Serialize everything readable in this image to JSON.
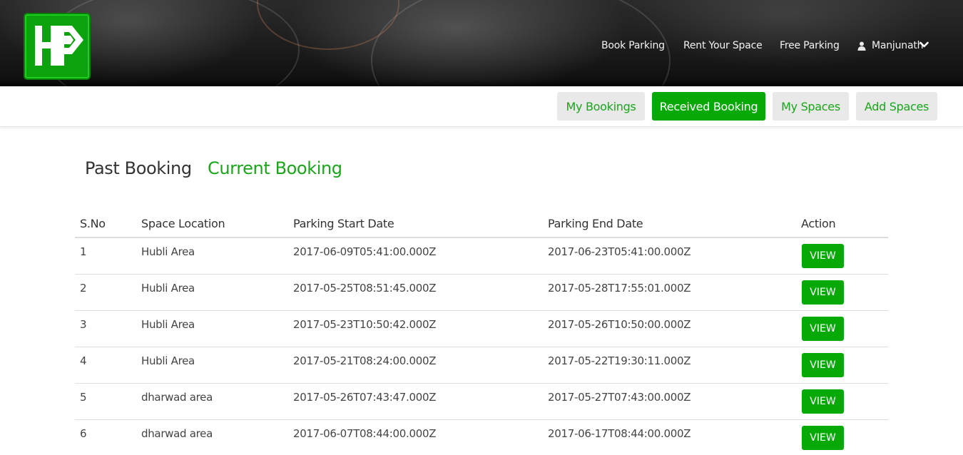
{
  "header": {
    "nav": {
      "book_parking": "Book Parking",
      "rent_space": "Rent Your Space",
      "free_parking": "Free Parking",
      "user_name": "Manjunath"
    },
    "icons": {
      "user": "user-icon",
      "dropdown": "chevron-down-icon"
    }
  },
  "subnav": {
    "tabs": [
      {
        "label": "My Bookings",
        "active": false
      },
      {
        "label": "Received Booking",
        "active": true
      },
      {
        "label": "My Spaces",
        "active": false
      },
      {
        "label": "Add Spaces",
        "active": false
      }
    ]
  },
  "booking_toggle": {
    "past": "Past Booking",
    "current": "Current Booking",
    "selected": "current"
  },
  "table": {
    "headers": {
      "sno": "S.No",
      "location": "Space Location",
      "start": "Parking Start Date",
      "end": "Parking End Date",
      "action": "Action"
    },
    "view_label": "VIEW",
    "rows": [
      {
        "sno": "1",
        "location": "Hubli Area",
        "start": "2017-06-09T05:41:00.000Z",
        "end": "2017-06-23T05:41:00.000Z"
      },
      {
        "sno": "2",
        "location": "Hubli Area",
        "start": "2017-05-25T08:51:45.000Z",
        "end": "2017-05-28T17:55:01.000Z"
      },
      {
        "sno": "3",
        "location": "Hubli Area",
        "start": "2017-05-23T10:50:42.000Z",
        "end": "2017-05-26T10:50:00.000Z"
      },
      {
        "sno": "4",
        "location": "Hubli Area",
        "start": "2017-05-21T08:24:00.000Z",
        "end": "2017-05-22T19:30:11.000Z"
      },
      {
        "sno": "5",
        "location": "dharwad area",
        "start": "2017-05-26T07:43:47.000Z",
        "end": "2017-05-27T07:43:00.000Z"
      },
      {
        "sno": "6",
        "location": "dharwad area",
        "start": "2017-06-07T08:44:00.000Z",
        "end": "2017-06-17T08:44:00.000Z"
      }
    ]
  },
  "colors": {
    "accent": "#07a907",
    "accent_text": "#1aa51a",
    "tab_inactive_bg": "#e9e9e9"
  }
}
